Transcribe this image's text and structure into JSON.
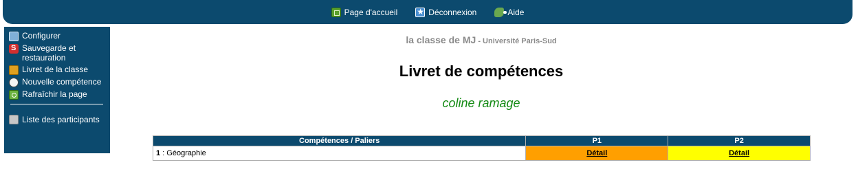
{
  "topnav": {
    "items": [
      {
        "label": "Page d'accueil",
        "icon": "home-icon"
      },
      {
        "label": "Déconnexion",
        "icon": "logout-icon"
      },
      {
        "label": "Aide",
        "icon": "help-icon"
      }
    ]
  },
  "sidebar": {
    "items": [
      {
        "label": "Configurer",
        "icon": "configure-icon"
      },
      {
        "label": "Sauvegarde et restauration",
        "icon": "backup-icon"
      },
      {
        "label": "Livret de la classe",
        "icon": "booklet-icon"
      },
      {
        "label": "Nouvelle compétence",
        "icon": "new-competence-icon"
      },
      {
        "label": "Rafraîchir la page",
        "icon": "refresh-icon"
      }
    ],
    "participants": {
      "label": "Liste des participants",
      "icon": "participants-icon"
    }
  },
  "course": {
    "name": "la classe de MJ",
    "university": " - Université Paris-Sud"
  },
  "page_title": "Livret de compétences",
  "student_name": "coline ramage",
  "table": {
    "headers": [
      "Compétences / Paliers",
      "P1",
      "P2"
    ],
    "rows": [
      {
        "number": "1",
        "name": " : Géographie",
        "cells": [
          {
            "label": "Détail",
            "color": "#ff9f00"
          },
          {
            "label": "Détail",
            "color": "#ffff00"
          }
        ]
      }
    ]
  },
  "colors": {
    "brand": "#0c4a6e",
    "student_name": "#138a13",
    "course_text": "#8a8a8a"
  }
}
